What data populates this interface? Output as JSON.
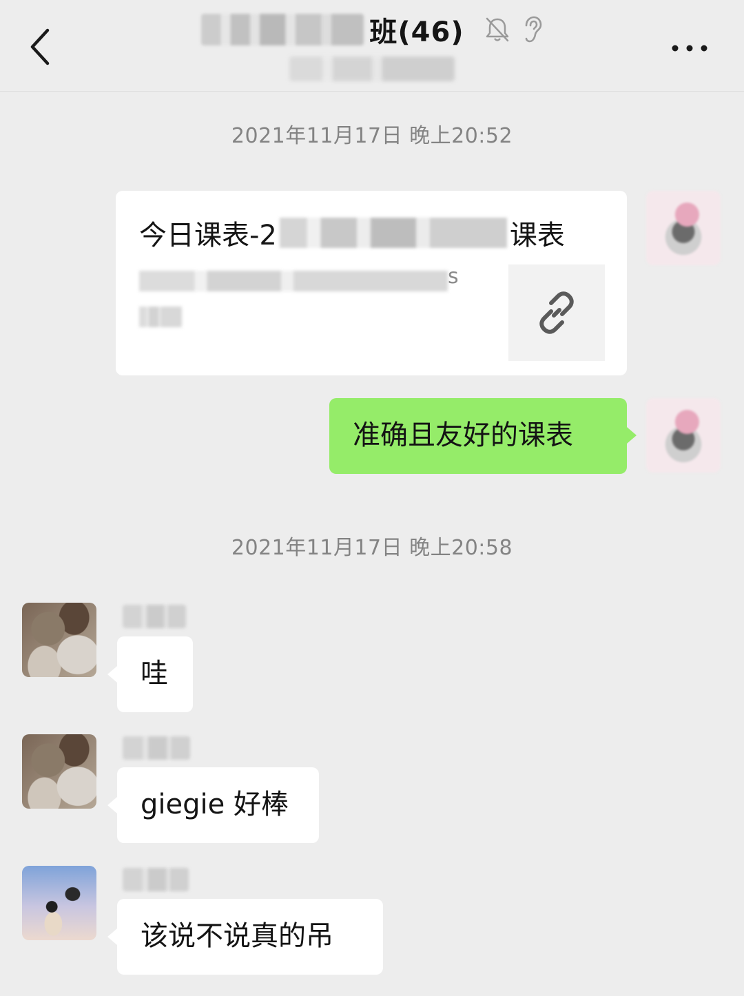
{
  "header": {
    "title_suffix": "班(46)",
    "icons": [
      "back-chevron-icon",
      "mute-bell-icon",
      "earpiece-icon",
      "more-icon"
    ]
  },
  "colors": {
    "background": "#ededed",
    "bubble_mine": "#95ec69",
    "bubble_other": "#ffffff"
  },
  "chat": {
    "timestamp1": "2021年11月17日 晚上20:52",
    "link_card": {
      "title_prefix": "今日课表-2",
      "title_suffix": "课表",
      "url_tail": "s"
    },
    "msg_mine": "准确且友好的课表",
    "timestamp2": "2021年11月17日 晚上20:58",
    "msg1": "哇",
    "msg2": "giegie 好棒",
    "msg3": "该说不说真的吊"
  }
}
